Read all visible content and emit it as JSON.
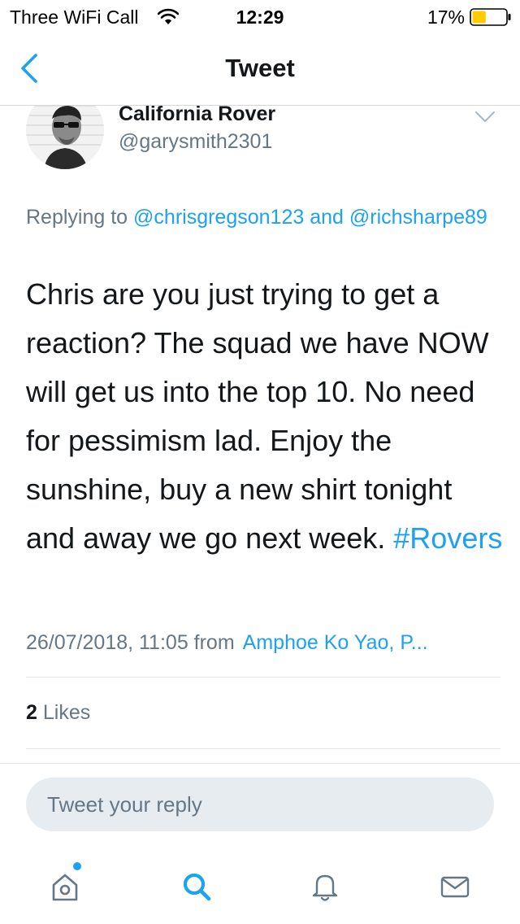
{
  "status_bar": {
    "carrier": "Three WiFi Call",
    "time": "12:29",
    "battery_percent": "17%",
    "battery_level": 0.17,
    "icons": [
      "wifi-icon",
      "battery-icon"
    ]
  },
  "nav": {
    "title": "Tweet",
    "back_icon": "back-chevron-icon"
  },
  "tweet": {
    "author_name": "California Rover",
    "author_handle": "@garysmith2301",
    "replying_prefix": "Replying to",
    "replying_mention_1": "@chrisgregson123",
    "replying_and": "and",
    "replying_mention_2": "@richsharpe89",
    "body_text": "Chris are you just trying to get a reaction? The squad we have NOW will get us into the top 10. No need for pessimism lad. Enjoy the sunshine, buy a new shirt tonight and away we go next week.",
    "hashtag": "#Rovers",
    "timestamp": "26/07/2018, 11:05 from",
    "location": "Amphoe Ko Yao, P...",
    "likes_count": "2",
    "likes_label": "Likes"
  },
  "reply": {
    "placeholder": "Tweet your reply"
  },
  "tab_bar": {
    "items": [
      "home-icon",
      "search-icon",
      "notifications-bell-icon",
      "messages-envelope-icon"
    ]
  },
  "colors": {
    "accent": "#1da1f2",
    "secondary_text": "#657786",
    "primary_text": "#14171a",
    "reply_bg": "#e6ecf0",
    "battery_fill": "#ffcc00"
  }
}
